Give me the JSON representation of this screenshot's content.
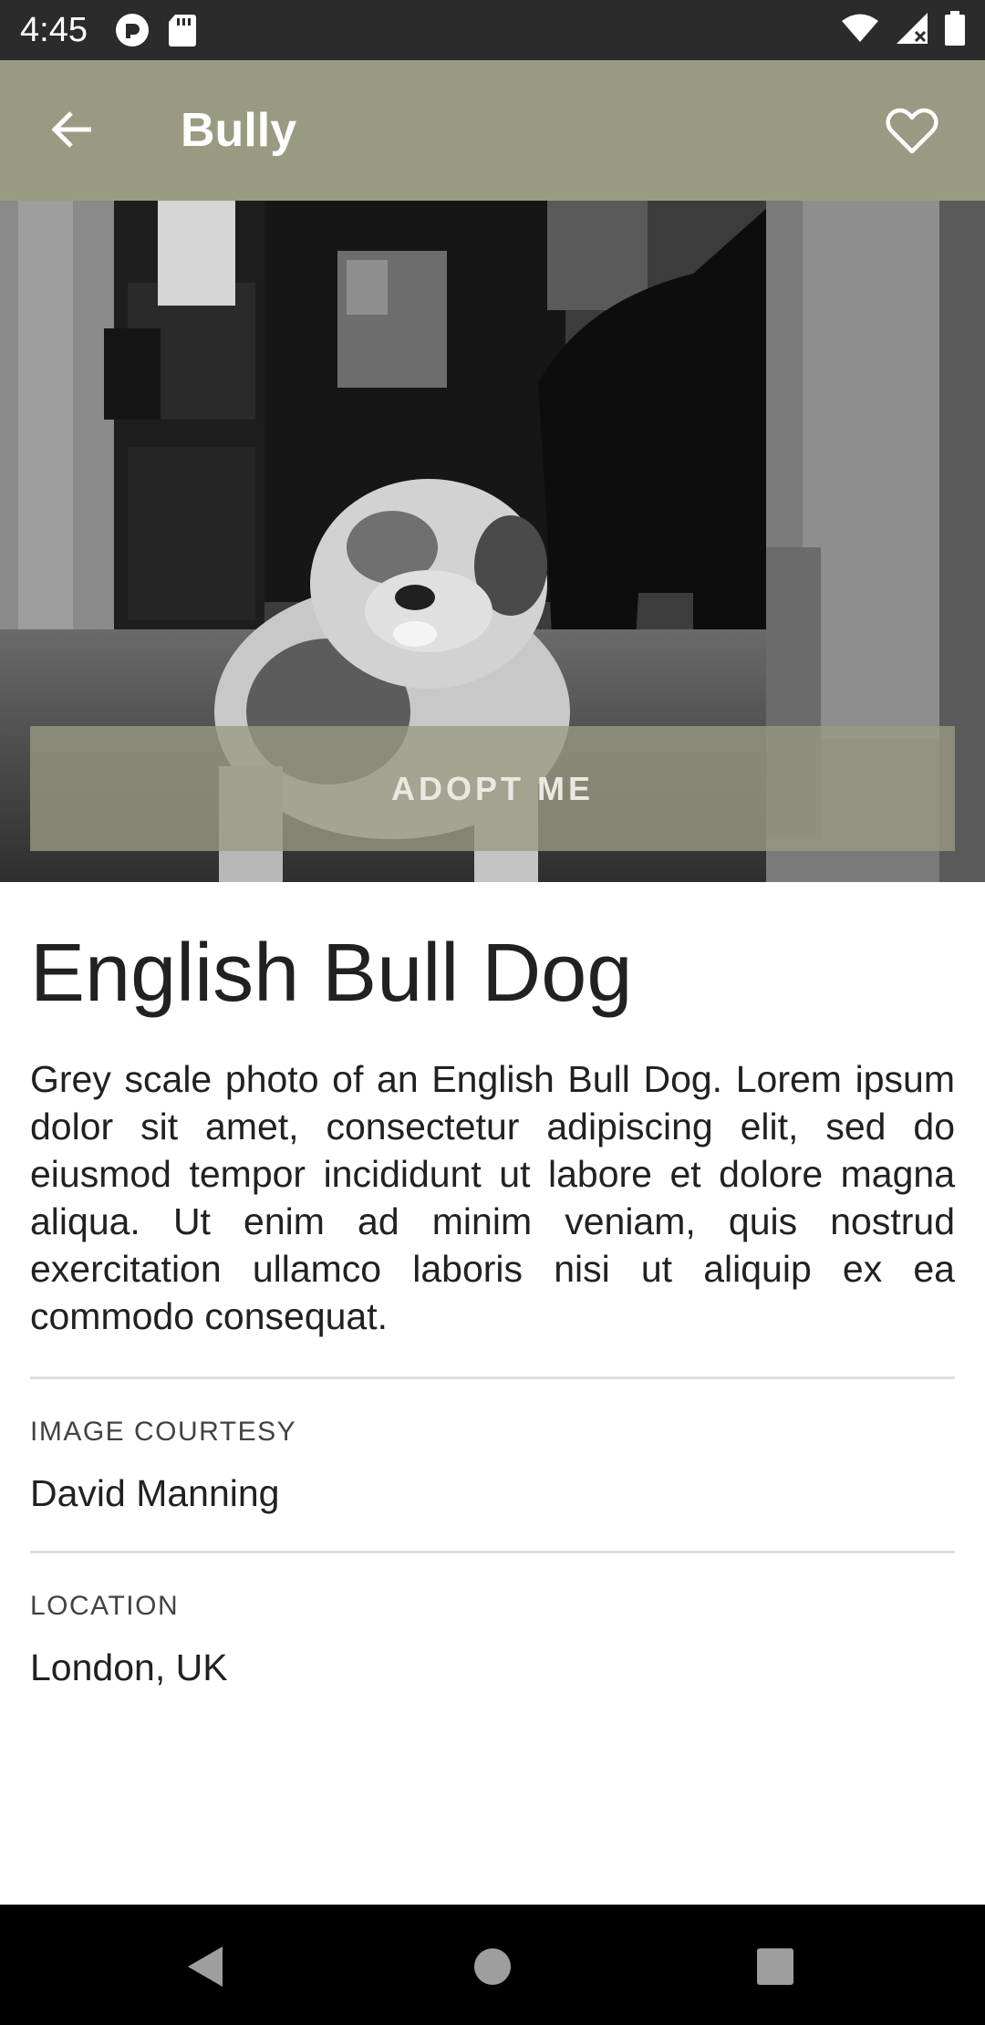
{
  "status_bar": {
    "time": "4:45",
    "left_icons": [
      "pocket-casts-icon",
      "sd-card-icon"
    ],
    "right_icons": [
      "wifi-icon",
      "cellular-signal-icon",
      "battery-icon"
    ]
  },
  "app_bar": {
    "title": "Bully",
    "back_icon": "arrow-back-icon",
    "favorite_icon": "heart-outline-icon",
    "color": "#9a9a82"
  },
  "hero": {
    "adopt_label": "ADOPT ME"
  },
  "details": {
    "title": "English Bull Dog",
    "description": "Grey scale photo of an English Bull Dog. Lorem ipsum dolor sit amet, consectetur adipiscing elit, sed do eiusmod tempor incididunt ut labore et dolore magna aliqua. Ut enim ad minim veniam, quis nostrud exercitation ullamco laboris nisi ut aliquip ex ea commodo consequat.",
    "image_courtesy_label": "IMAGE COURTESY",
    "image_courtesy_value": "David Manning",
    "location_label": "LOCATION",
    "location_value": "London, UK"
  },
  "nav_bar": {
    "icons": [
      "back-triangle-icon",
      "home-circle-icon",
      "recents-square-icon"
    ]
  }
}
